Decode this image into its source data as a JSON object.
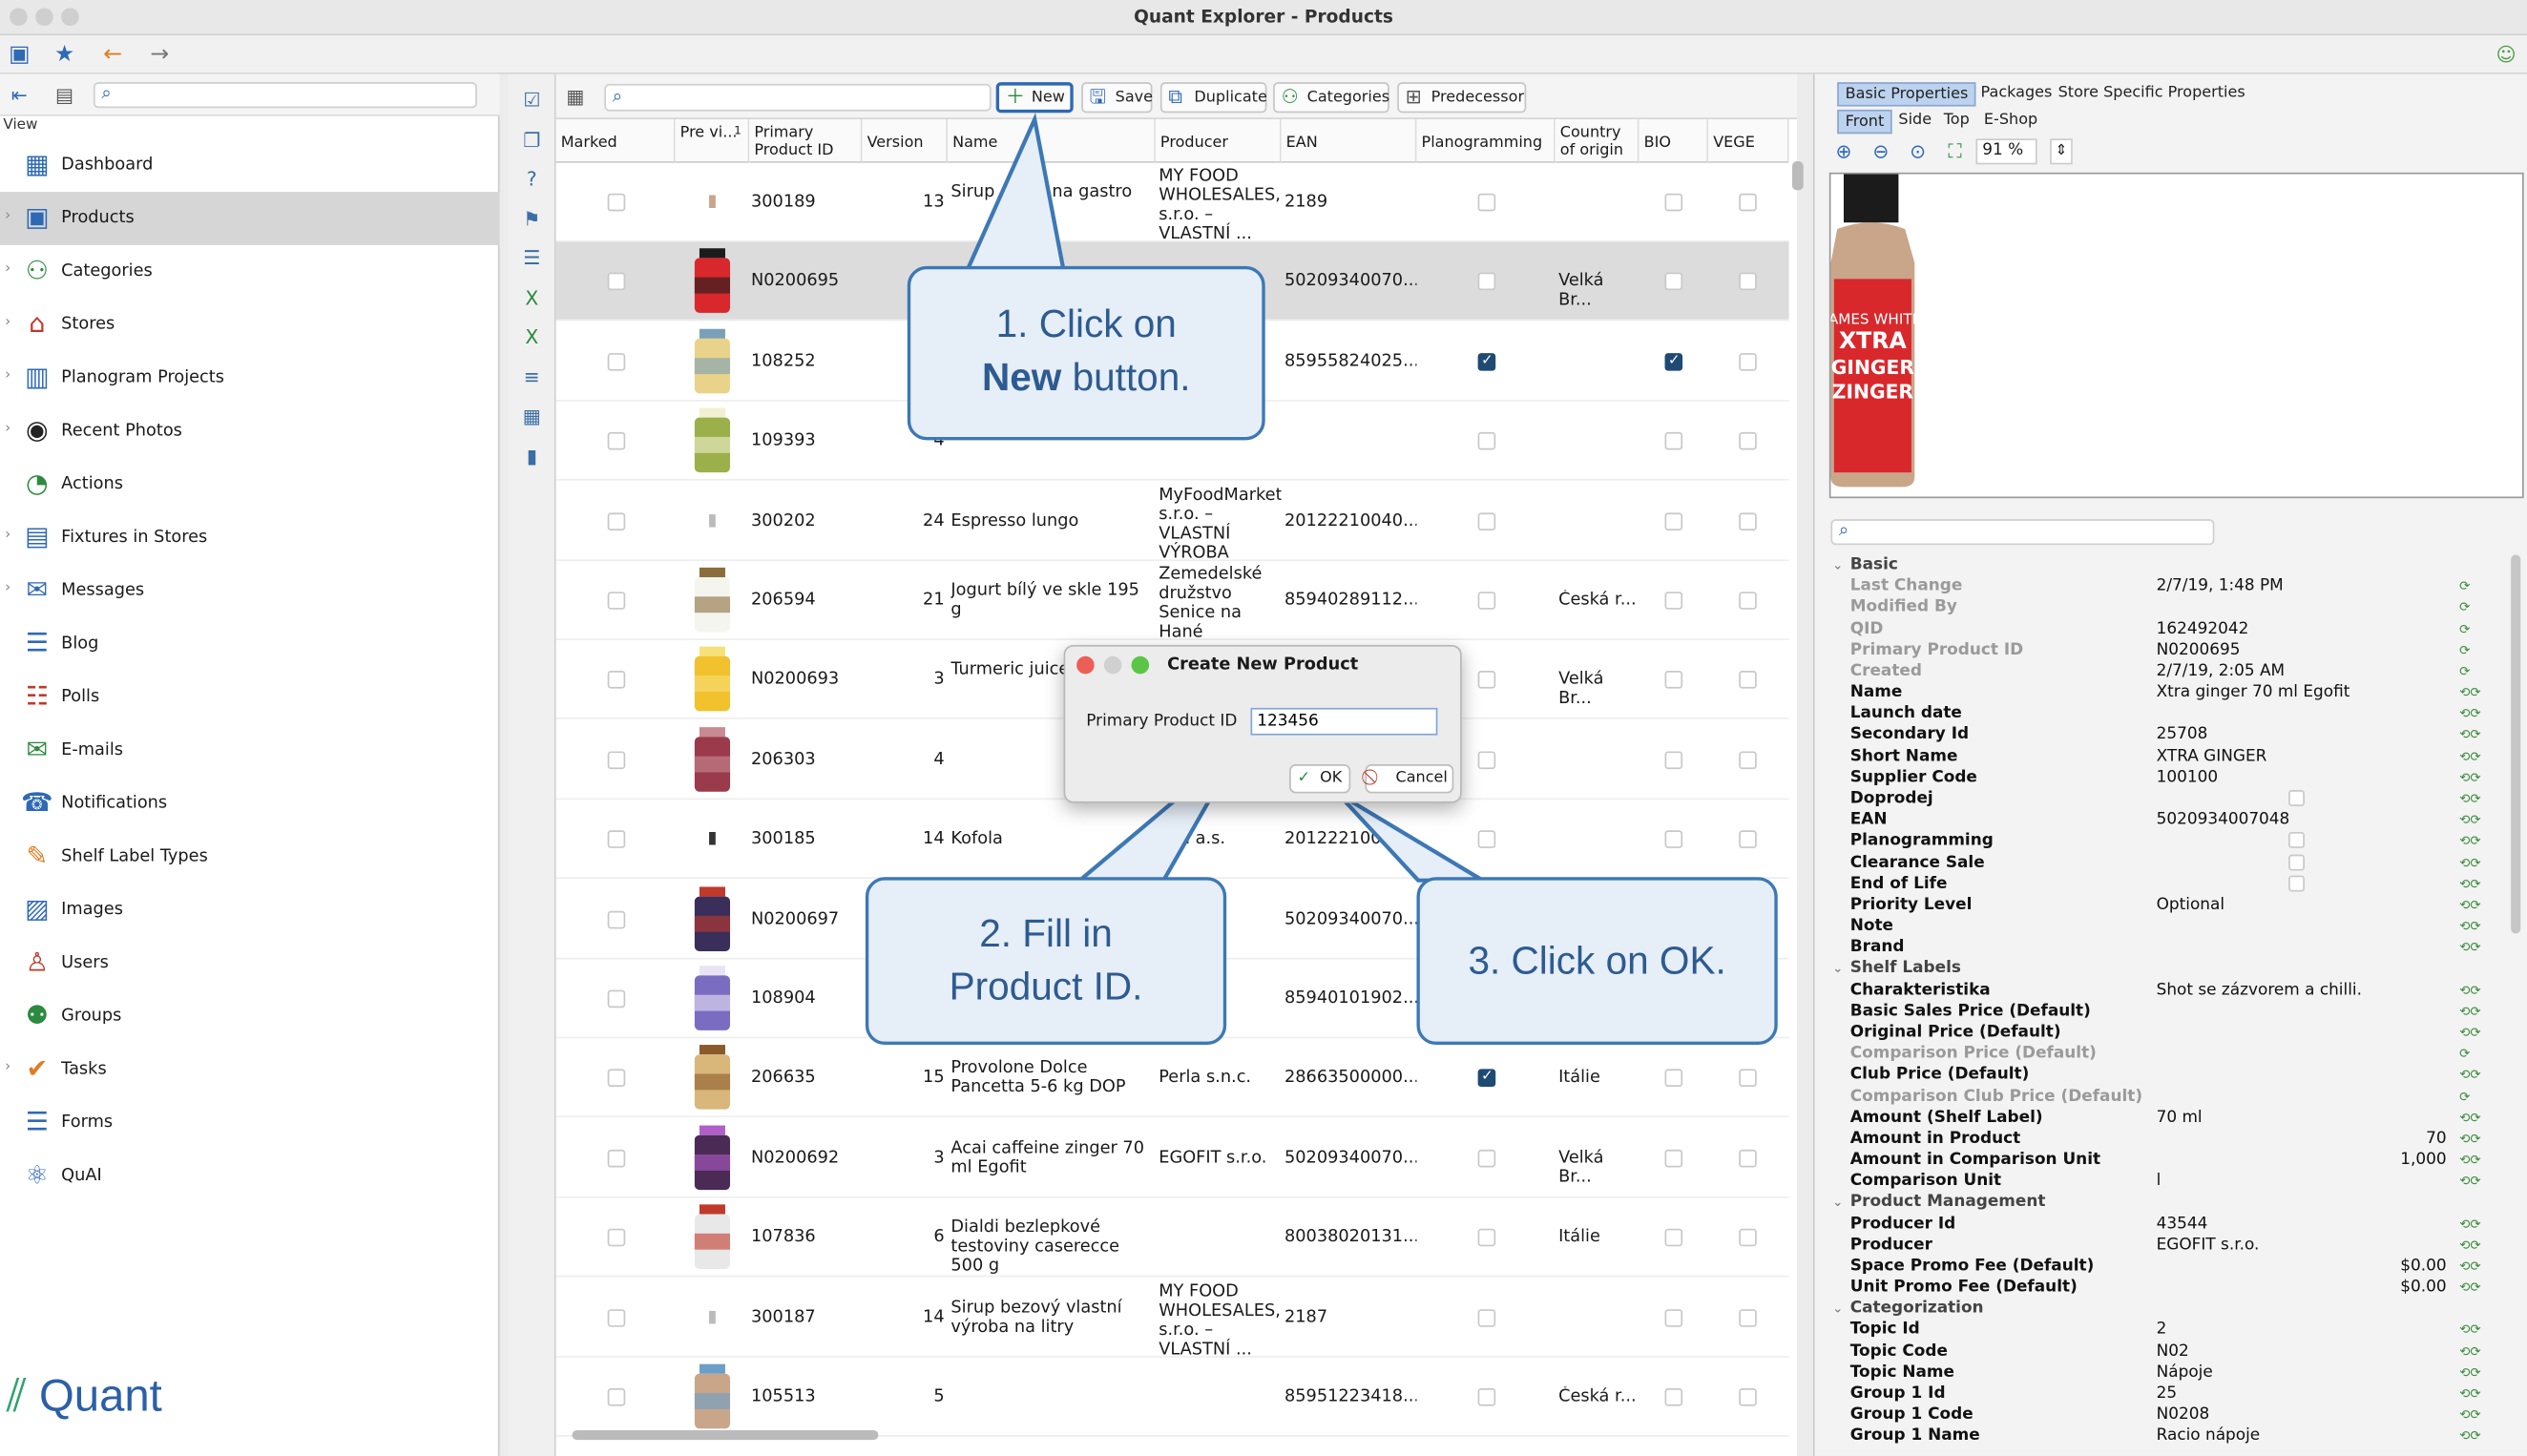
{
  "window": {
    "title": "Quant Explorer - Products"
  },
  "nav": {
    "view_label": "View",
    "items": [
      {
        "label": "Dashboard",
        "icon": "dashboard-icon"
      },
      {
        "label": "Products",
        "icon": "products-icon"
      },
      {
        "label": "Categories",
        "icon": "categories-icon"
      },
      {
        "label": "Stores",
        "icon": "stores-icon"
      },
      {
        "label": "Planogram Projects",
        "icon": "planogram-icon"
      },
      {
        "label": "Recent Photos",
        "icon": "camera-icon"
      },
      {
        "label": "Actions",
        "icon": "clock-icon"
      },
      {
        "label": "Fixtures in Stores",
        "icon": "fixtures-icon"
      },
      {
        "label": "Messages",
        "icon": "messages-icon"
      },
      {
        "label": "Blog",
        "icon": "blog-icon"
      },
      {
        "label": "Polls",
        "icon": "polls-icon"
      },
      {
        "label": "E-mails",
        "icon": "mail-icon"
      },
      {
        "label": "Notifications",
        "icon": "notifications-icon"
      },
      {
        "label": "Shelf Label Types",
        "icon": "shelf-label-icon"
      },
      {
        "label": "Images",
        "icon": "images-icon"
      },
      {
        "label": "Users",
        "icon": "user-icon"
      },
      {
        "label": "Groups",
        "icon": "groups-icon"
      },
      {
        "label": "Tasks",
        "icon": "tasks-icon"
      },
      {
        "label": "Forms",
        "icon": "forms-icon"
      },
      {
        "label": "QuAI",
        "icon": "ai-icon"
      }
    ],
    "selected": "Products"
  },
  "logo": {
    "text": "Quant"
  },
  "grid_toolbar": {
    "new": "New",
    "save": "Save",
    "duplicate": "Duplicate",
    "categories": "Categories",
    "predecessor": "Predecessor"
  },
  "grid": {
    "columns": [
      "Marked",
      "Pre vi...",
      "Primary Product ID",
      "Version",
      "Name",
      "Producer",
      "EAN",
      "Planogramming",
      "Country of origin",
      "BIO",
      "VEGE"
    ],
    "sort_indicator": "1",
    "rows": [
      {
        "id": "300189",
        "version": "13",
        "name": "Sirup ...ový na gastro",
        "producer": "MY FOOD WHOLESALES, s.r.o. – VLASTNÍ ...",
        "ean": "2189",
        "plano": false,
        "country": "",
        "bio": false
      },
      {
        "id": "N0200695",
        "version": "",
        "name": "",
        "producer": "",
        "ean": "50209340070...",
        "plano": false,
        "country": "Velká Br...",
        "bio": false
      },
      {
        "id": "108252",
        "version": "",
        "name": "",
        "producer": "",
        "ean": "85955824025...",
        "plano": true,
        "country": "",
        "bio": true
      },
      {
        "id": "109393",
        "version": "4",
        "name": "",
        "producer": "",
        "ean": "",
        "plano": false,
        "country": "",
        "bio": false
      },
      {
        "id": "300202",
        "version": "24",
        "name": "Espresso lungo",
        "producer": "MyFoodMarket, s.r.o. – VLASTNÍ VÝROBA",
        "ean": "20122210040...",
        "plano": false,
        "country": "",
        "bio": false
      },
      {
        "id": "206594",
        "version": "21",
        "name": "Jogurt bílý ve skle 195 g",
        "producer": "Zemedelské družstvo Senice na Hané",
        "ean": "85940289112...",
        "plano": false,
        "country": "Česká r...",
        "bio": false
      },
      {
        "id": "N0200693",
        "version": "3",
        "name": "Turmeric juice ml Egofit",
        "producer": "",
        "ean": "",
        "plano": false,
        "country": "Velká Br...",
        "bio": false
      },
      {
        "id": "206303",
        "version": "4",
        "name": "",
        "producer": "",
        "ean": "",
        "plano": false,
        "country": "",
        "bio": false
      },
      {
        "id": "300185",
        "version": "14",
        "name": "Kofola",
        "producer": "...la a.s.",
        "ean": "20122210037...",
        "plano": false,
        "country": "",
        "bio": false
      },
      {
        "id": "N0200697",
        "version": "",
        "name": "",
        "producer": "...r.o.",
        "ean": "50209340070...",
        "plano": false,
        "country": "Velká Br...",
        "bio": false
      },
      {
        "id": "108904",
        "version": "",
        "name": "",
        "producer": "",
        "ean": "85940101902...",
        "plano": false,
        "country": "",
        "bio": false
      },
      {
        "id": "206635",
        "version": "15",
        "name": "Provolone Dolce Pancetta 5-6 kg DOP",
        "producer": "Perla s.n.c.",
        "ean": "28663500000...",
        "plano": true,
        "country": "Itálie",
        "bio": false
      },
      {
        "id": "N0200692",
        "version": "3",
        "name": "Acai caffeine zinger 70 ml Egofit",
        "producer": "EGOFIT s.r.o.",
        "ean": "50209340070...",
        "plano": false,
        "country": "Velká Br...",
        "bio": false
      },
      {
        "id": "107836",
        "version": "6",
        "name": "Dialdi bezlepkové testoviny caserecce 500 g",
        "producer": "",
        "ean": "80038020131...",
        "plano": false,
        "country": "Itálie",
        "bio": false
      },
      {
        "id": "300187",
        "version": "14",
        "name": "Sirup bezový vlastní výroba na litry",
        "producer": "MY FOOD WHOLESALES, s.r.o. – VLASTNÍ ...",
        "ean": "2187",
        "plano": false,
        "country": "",
        "bio": false
      },
      {
        "id": "105513",
        "version": "5",
        "name": "",
        "producer": "",
        "ean": "85951223418...",
        "plano": false,
        "country": "Česká r...",
        "bio": false
      }
    ]
  },
  "dialog": {
    "title": "Create New Product",
    "field_label": "Primary Product ID",
    "field_value": "123456",
    "ok": "OK",
    "cancel": "Cancel"
  },
  "callouts": {
    "c1_line1": "1. Click on",
    "c1_bold": "New",
    "c1_rest": " button.",
    "c2_line1": "2. Fill in",
    "c2_line2": "Product ID.",
    "c3": "3. Click on OK."
  },
  "right": {
    "tabs": [
      "Basic Properties",
      "Packages",
      "Store Specific Properties"
    ],
    "subtabs": [
      "Front",
      "Side",
      "Top",
      "E-Shop"
    ],
    "zoom": "91 %",
    "product_image_text": [
      "JAMES WHITE",
      "XTRA",
      "GINGER",
      "ZINGER"
    ],
    "props": [
      {
        "group": true,
        "k": "Basic"
      },
      {
        "k": "Last Change",
        "v": "2/7/19, 1:48 PM",
        "gray": true
      },
      {
        "k": "Modified By",
        "v": "",
        "gray": true
      },
      {
        "k": "QID",
        "v": "162492042",
        "gray": true
      },
      {
        "k": "Primary Product ID",
        "v": "N0200695",
        "gray": true
      },
      {
        "k": "Created",
        "v": "2/7/19, 2:05 AM",
        "gray": true
      },
      {
        "k": "Name",
        "v": "Xtra ginger 70 ml Egofit"
      },
      {
        "k": "Launch date",
        "v": ""
      },
      {
        "k": "Secondary Id",
        "v": "25708"
      },
      {
        "k": "Short Name",
        "v": "XTRA GINGER"
      },
      {
        "k": "Supplier Code",
        "v": "100100"
      },
      {
        "k": "Doprodej",
        "v": "",
        "check": true
      },
      {
        "k": "EAN",
        "v": "5020934007048"
      },
      {
        "k": "Planogramming",
        "v": "",
        "check": true
      },
      {
        "k": "Clearance Sale",
        "v": "",
        "check": true
      },
      {
        "k": "End of Life",
        "v": "",
        "check": true
      },
      {
        "k": "Priority Level",
        "v": "Optional"
      },
      {
        "k": "Note",
        "v": ""
      },
      {
        "k": "Brand",
        "v": ""
      },
      {
        "group": true,
        "k": "Shelf Labels"
      },
      {
        "k": "Charakteristika",
        "v": "Shot se zázvorem a chilli."
      },
      {
        "k": "Basic Sales Price (Default)",
        "v": ""
      },
      {
        "k": "Original Price (Default)",
        "v": ""
      },
      {
        "k": "Comparison Price (Default)",
        "v": "",
        "gray": true
      },
      {
        "k": "Club Price (Default)",
        "v": ""
      },
      {
        "k": "Comparison Club Price (Default)",
        "v": "",
        "gray": true
      },
      {
        "k": "Amount (Shelf Label)",
        "v": "70 ml"
      },
      {
        "k": "Amount in Product",
        "v": "70",
        "right": true
      },
      {
        "k": "Amount in Comparison Unit",
        "v": "1,000",
        "right": true
      },
      {
        "k": "Comparison Unit",
        "v": "l"
      },
      {
        "group": true,
        "k": "Product Management"
      },
      {
        "k": "Producer Id",
        "v": "43544"
      },
      {
        "k": "Producer",
        "v": "EGOFIT s.r.o."
      },
      {
        "k": "Space Promo Fee (Default)",
        "v": "$0.00",
        "right": true
      },
      {
        "k": "Unit Promo Fee (Default)",
        "v": "$0.00",
        "right": true
      },
      {
        "group": true,
        "k": "Categorization"
      },
      {
        "k": "Topic Id",
        "v": "2"
      },
      {
        "k": "Topic Code",
        "v": "N02"
      },
      {
        "k": "Topic Name",
        "v": "Nápoje"
      },
      {
        "k": "Group 1 Id",
        "v": "25"
      },
      {
        "k": "Group 1 Code",
        "v": "N0208"
      },
      {
        "k": "Group 1 Name",
        "v": "Racio nápoje"
      }
    ]
  },
  "colors": {
    "accent": "#2e69b6",
    "callout_border": "#3d78b5",
    "callout_fill": "#e6eef7",
    "selected_row": "#dcdcdc"
  }
}
